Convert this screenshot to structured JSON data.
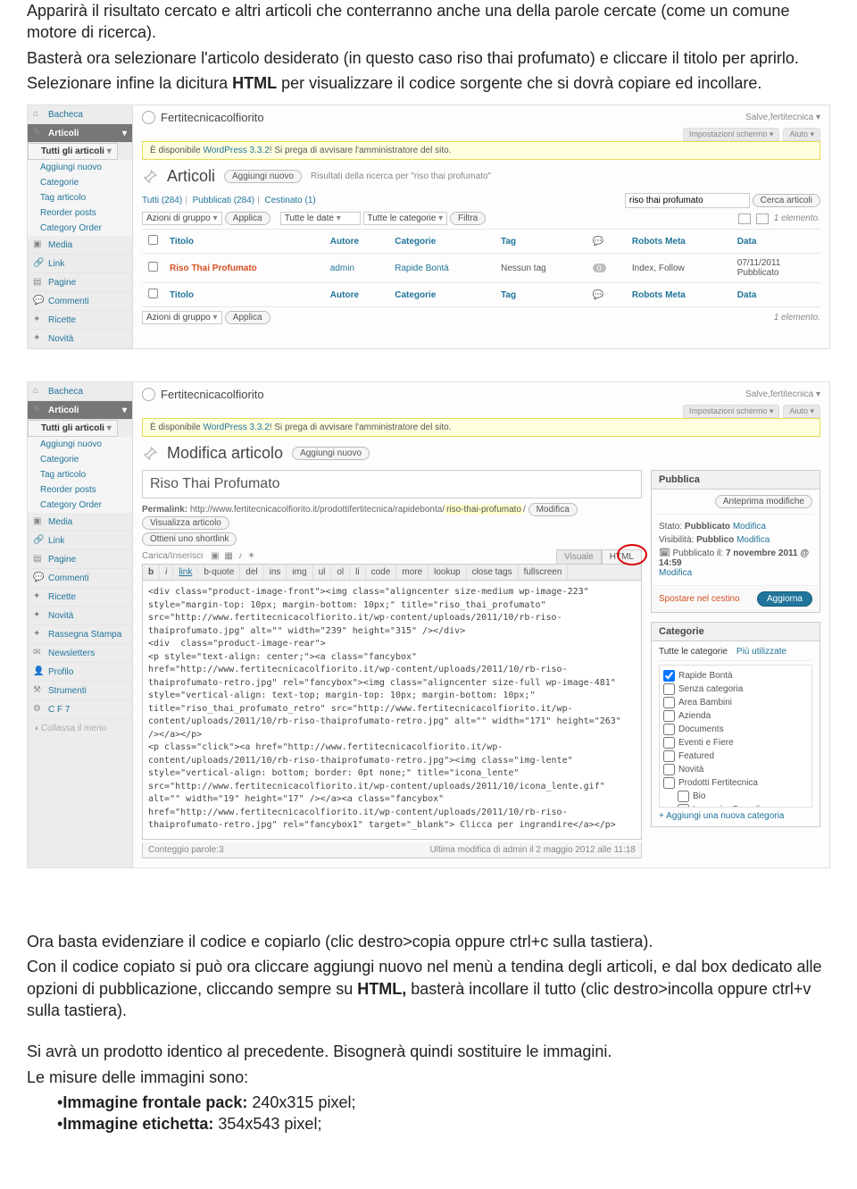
{
  "doc": {
    "p1": "Apparirà il risultato cercato e altri articoli che conterranno anche una della parole cercate (come un comune motore di ricerca).",
    "p2": "Basterà ora selezionare l'articolo desiderato (in questo caso riso thai profumato) e cliccare il titolo per aprirlo.",
    "p3a": "Selezionare infine la dicitura ",
    "p3b": "HTML",
    "p3c": " per visualizzare il codice sorgente che si dovrà copiare ed incollare.",
    "p4": "Ora basta evidenziare il codice e copiarlo (clic destro>copia oppure ctrl+c sulla tastiera).",
    "p5a": "Con il codice copiato si può ora cliccare aggiungi nuovo nel menù a tendina degli articoli, e dal box dedicato alle opzioni di pubblicazione, cliccando sempre su ",
    "p5b": "HTML,",
    "p5c": " basterà incollare il tutto (clic destro>incolla oppure ctrl+v sulla tastiera).",
    "p6": "Si avrà un prodotto identico al precedente. Bisognerà quindi sostituire le immagini.",
    "p7": "Le misure delle immagini sono:",
    "b1a": "Immagine frontale pack:",
    "b1b": " 240x315 pixel;",
    "b2a": "Immagine etichetta:",
    "b2b": " 354x543 pixel;"
  },
  "sidebar": {
    "bacheca": "Bacheca",
    "articoli": "Articoli",
    "sub_all": "Tutti gli articoli",
    "sub_new": "Aggiungi nuovo",
    "sub_cat": "Categorie",
    "sub_tag": "Tag articolo",
    "sub_reorder": "Reorder posts",
    "sub_catorder": "Category Order",
    "media": "Media",
    "link": "Link",
    "pagine": "Pagine",
    "commenti": "Commenti",
    "ricette": "Ricette",
    "novita": "Novità",
    "rassegna": "Rassegna Stampa",
    "newsletters": "Newsletters",
    "profilo": "Profilo",
    "strumenti": "Strumenti",
    "cf7": "C F 7",
    "collapse": "Collassa il menu"
  },
  "wp": {
    "sitename": "Fertitecnicacolfiorito",
    "salve": "Salve,fertitecnica ▾",
    "screen_opts": "Impostazioni schermo ▾",
    "help": "Aiuto ▾",
    "notice_a": "È disponibile ",
    "notice_link": "WordPress 3.3.2",
    "notice_b": "! Si prega di avvisare l'amministratore del sito."
  },
  "list": {
    "h2": "Articoli",
    "addnew": "Aggiungi nuovo",
    "results_for": "Risultati della ricerca per \"riso thai profumato\"",
    "filters_all": "Tutti (284)",
    "filters_pub": "Pubblicati (284)",
    "filters_trash": "Cestinato (1)",
    "search_val": "riso thai profumato",
    "search_btn": "Cerca articoli",
    "bulk": "Azioni di gruppo",
    "apply": "Applica",
    "dates": "Tutte le date",
    "cats": "Tutte le categorie",
    "filter": "Filtra",
    "one_el": "1 elemento.",
    "th_title": "Titolo",
    "th_author": "Autore",
    "th_cat": "Categorie",
    "th_tag": "Tag",
    "th_robots": "Robots Meta",
    "th_date": "Data",
    "row_title": "Riso Thai Profumato",
    "row_author": "admin",
    "row_cat": "Rapide Bontà",
    "row_tag": "Nessun tag",
    "row_comments": "0",
    "row_robots": "Index, Follow",
    "row_date1": "07/11/2011",
    "row_date2": "Pubblicato"
  },
  "editor": {
    "h2": "Modifica articolo",
    "addnew": "Aggiungi nuovo",
    "title": "Riso Thai Profumato",
    "permalink_label": "Permalink:",
    "permalink_base": " http://www.fertitecnicacolfiorito.it/prodottifertitecnica/rapidebonta/",
    "permalink_slug": "riso-thai-profumato",
    "permalink_end": "/",
    "btn_mod": "Modifica",
    "btn_view": "Visualizza articolo",
    "btn_short": "Ottieni uno shortlink",
    "upload": "Carica/Inserisci",
    "tab_v": "Visuale",
    "tab_h": "HTML",
    "tb": {
      "b": "b",
      "i": "i",
      "link": "link",
      "bq": "b-quote",
      "del": "del",
      "ins": "ins",
      "img": "img",
      "ul": "ul",
      "ol": "ol",
      "li": "li",
      "code": "code",
      "more": "more",
      "lookup": "lookup",
      "close": "close tags",
      "full": "fullscreen"
    },
    "content": "<div class=\"product-image-front\"><img class=\"aligncenter size-medium wp-image-223\" style=\"margin-top: 10px; margin-bottom: 10px;\" title=\"riso_thai_profumato\" src=\"http://www.fertitecnicacolfiorito.it/wp-content/uploads/2011/10/rb-riso-thaiprofumato.jpg\" alt=\"\" width=\"239\" height=\"315\" /></div>\n<div  class=\"product-image-rear\">\n<p style=\"text-align: center;\"><a class=\"fancybox\" href=\"http://www.fertitecnicacolfiorito.it/wp-content/uploads/2011/10/rb-riso-thaiprofumato-retro.jpg\" rel=\"fancybox\"><img class=\"aligncenter size-full wp-image-481\" style=\"vertical-align: text-top; margin-top: 10px; margin-bottom: 10px;\" title=\"riso_thai_profumato_retro\" src=\"http://www.fertitecnicacolfiorito.it/wp-content/uploads/2011/10/rb-riso-thaiprofumato-retro.jpg\" alt=\"\" width=\"171\" height=\"263\" /></a></p>\n<p class=\"click\"><a href=\"http://www.fertitecnicacolfiorito.it/wp-content/uploads/2011/10/rb-riso-thaiprofumato-retro.jpg\"><img class=\"img-lente\" style=\"vertical-align: bottom; border: 0pt none;\" title=\"icona_lente\" src=\"http://www.fertitecnicacolfiorito.it/wp-content/uploads/2011/10/icona_lente.gif\" alt=\"\" width=\"19\" height=\"17\" /></a><a class=\"fancybox\" href=\"http://www.fertitecnicacolfiorito.it/wp-content/uploads/2011/10/rb-riso-thaiprofumato-retro.jpg\" rel=\"fancybox1\" target=\"_blank\"> Clicca per ingrandire</a></p>\n\n</div>",
    "wc": "Conteggio parole:3",
    "lastmod": "Ultima modifica di admin il 2 maggio 2012 alle 11:18"
  },
  "publish": {
    "h": "Pubblica",
    "preview": "Anteprima modifiche",
    "status_lbl": "Stato: ",
    "status_val": "Pubblicato",
    "mod": "Modifica",
    "vis_lbl": "Visibilità: ",
    "vis_val": "Pubblico",
    "pubon_lbl": "Pubblicato il: ",
    "pubon_val": "7 novembre 2011 @ 14:59",
    "trash": "Spostare nel cestino",
    "update": "Aggiorna"
  },
  "cats": {
    "h": "Categorie",
    "tab_all": "Tutte le categorie",
    "tab_pop": "Più utilizzate",
    "items": [
      {
        "label": "Rapide Bontà",
        "checked": true,
        "indent": 0
      },
      {
        "label": "Senza categoria",
        "checked": false,
        "indent": 0
      },
      {
        "label": "Area Bambini",
        "checked": false,
        "indent": 0
      },
      {
        "label": "Azienda",
        "checked": false,
        "indent": 0
      },
      {
        "label": "Documents",
        "checked": false,
        "indent": 0
      },
      {
        "label": "Eventi e Fiere",
        "checked": false,
        "indent": 0
      },
      {
        "label": "Featured",
        "checked": false,
        "indent": 0
      },
      {
        "label": "Novità",
        "checked": false,
        "indent": 0
      },
      {
        "label": "Prodotti Fertitecnica",
        "checked": false,
        "indent": 0
      },
      {
        "label": "Bio",
        "checked": false,
        "indent": 1
      },
      {
        "label": "Legumi e Cereali",
        "checked": false,
        "indent": 1
      }
    ],
    "add": "+ Aggiungi una nuova categoria"
  }
}
